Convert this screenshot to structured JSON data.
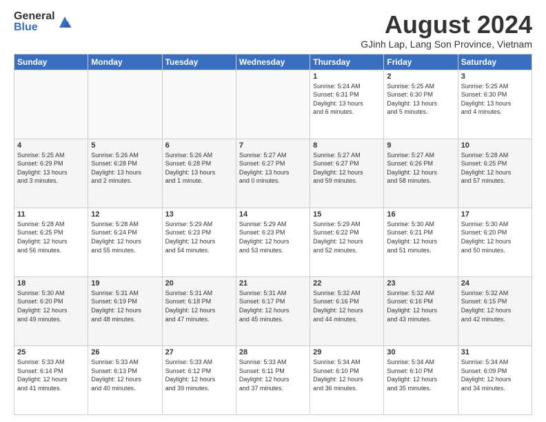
{
  "logo": {
    "general": "General",
    "blue": "Blue"
  },
  "title": "August 2024",
  "location": "GJinh Lap, Lang Son Province, Vietnam",
  "days_of_week": [
    "Sunday",
    "Monday",
    "Tuesday",
    "Wednesday",
    "Thursday",
    "Friday",
    "Saturday"
  ],
  "weeks": [
    [
      {
        "day": "",
        "info": ""
      },
      {
        "day": "",
        "info": ""
      },
      {
        "day": "",
        "info": ""
      },
      {
        "day": "",
        "info": ""
      },
      {
        "day": "1",
        "info": "Sunrise: 5:24 AM\nSunset: 6:31 PM\nDaylight: 13 hours\nand 6 minutes."
      },
      {
        "day": "2",
        "info": "Sunrise: 5:25 AM\nSunset: 6:30 PM\nDaylight: 13 hours\nand 5 minutes."
      },
      {
        "day": "3",
        "info": "Sunrise: 5:25 AM\nSunset: 6:30 PM\nDaylight: 13 hours\nand 4 minutes."
      }
    ],
    [
      {
        "day": "4",
        "info": "Sunrise: 5:25 AM\nSunset: 6:29 PM\nDaylight: 13 hours\nand 3 minutes."
      },
      {
        "day": "5",
        "info": "Sunrise: 5:26 AM\nSunset: 6:28 PM\nDaylight: 13 hours\nand 2 minutes."
      },
      {
        "day": "6",
        "info": "Sunrise: 5:26 AM\nSunset: 6:28 PM\nDaylight: 13 hours\nand 1 minute."
      },
      {
        "day": "7",
        "info": "Sunrise: 5:27 AM\nSunset: 6:27 PM\nDaylight: 13 hours\nand 0 minutes."
      },
      {
        "day": "8",
        "info": "Sunrise: 5:27 AM\nSunset: 6:27 PM\nDaylight: 12 hours\nand 59 minutes."
      },
      {
        "day": "9",
        "info": "Sunrise: 5:27 AM\nSunset: 6:26 PM\nDaylight: 12 hours\nand 58 minutes."
      },
      {
        "day": "10",
        "info": "Sunrise: 5:28 AM\nSunset: 6:25 PM\nDaylight: 12 hours\nand 57 minutes."
      }
    ],
    [
      {
        "day": "11",
        "info": "Sunrise: 5:28 AM\nSunset: 6:25 PM\nDaylight: 12 hours\nand 56 minutes."
      },
      {
        "day": "12",
        "info": "Sunrise: 5:28 AM\nSunset: 6:24 PM\nDaylight: 12 hours\nand 55 minutes."
      },
      {
        "day": "13",
        "info": "Sunrise: 5:29 AM\nSunset: 6:23 PM\nDaylight: 12 hours\nand 54 minutes."
      },
      {
        "day": "14",
        "info": "Sunrise: 5:29 AM\nSunset: 6:23 PM\nDaylight: 12 hours\nand 53 minutes."
      },
      {
        "day": "15",
        "info": "Sunrise: 5:29 AM\nSunset: 6:22 PM\nDaylight: 12 hours\nand 52 minutes."
      },
      {
        "day": "16",
        "info": "Sunrise: 5:30 AM\nSunset: 6:21 PM\nDaylight: 12 hours\nand 51 minutes."
      },
      {
        "day": "17",
        "info": "Sunrise: 5:30 AM\nSunset: 6:20 PM\nDaylight: 12 hours\nand 50 minutes."
      }
    ],
    [
      {
        "day": "18",
        "info": "Sunrise: 5:30 AM\nSunset: 6:20 PM\nDaylight: 12 hours\nand 49 minutes."
      },
      {
        "day": "19",
        "info": "Sunrise: 5:31 AM\nSunset: 6:19 PM\nDaylight: 12 hours\nand 48 minutes."
      },
      {
        "day": "20",
        "info": "Sunrise: 5:31 AM\nSunset: 6:18 PM\nDaylight: 12 hours\nand 47 minutes."
      },
      {
        "day": "21",
        "info": "Sunrise: 5:31 AM\nSunset: 6:17 PM\nDaylight: 12 hours\nand 45 minutes."
      },
      {
        "day": "22",
        "info": "Sunrise: 5:32 AM\nSunset: 6:16 PM\nDaylight: 12 hours\nand 44 minutes."
      },
      {
        "day": "23",
        "info": "Sunrise: 5:32 AM\nSunset: 6:16 PM\nDaylight: 12 hours\nand 43 minutes."
      },
      {
        "day": "24",
        "info": "Sunrise: 5:32 AM\nSunset: 6:15 PM\nDaylight: 12 hours\nand 42 minutes."
      }
    ],
    [
      {
        "day": "25",
        "info": "Sunrise: 5:33 AM\nSunset: 6:14 PM\nDaylight: 12 hours\nand 41 minutes."
      },
      {
        "day": "26",
        "info": "Sunrise: 5:33 AM\nSunset: 6:13 PM\nDaylight: 12 hours\nand 40 minutes."
      },
      {
        "day": "27",
        "info": "Sunrise: 5:33 AM\nSunset: 6:12 PM\nDaylight: 12 hours\nand 39 minutes."
      },
      {
        "day": "28",
        "info": "Sunrise: 5:33 AM\nSunset: 6:11 PM\nDaylight: 12 hours\nand 37 minutes."
      },
      {
        "day": "29",
        "info": "Sunrise: 5:34 AM\nSunset: 6:10 PM\nDaylight: 12 hours\nand 36 minutes."
      },
      {
        "day": "30",
        "info": "Sunrise: 5:34 AM\nSunset: 6:10 PM\nDaylight: 12 hours\nand 35 minutes."
      },
      {
        "day": "31",
        "info": "Sunrise: 5:34 AM\nSunset: 6:09 PM\nDaylight: 12 hours\nand 34 minutes."
      }
    ]
  ]
}
